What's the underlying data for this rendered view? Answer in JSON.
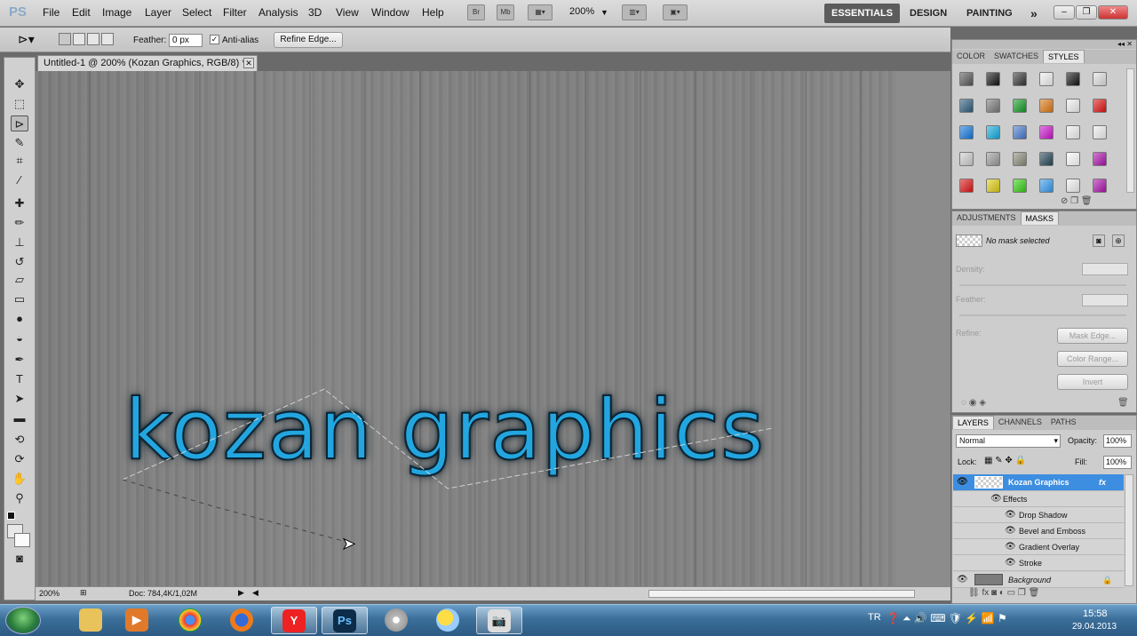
{
  "app": {
    "logo": "PS",
    "menu": [
      "File",
      "Edit",
      "Image",
      "Layer",
      "Select",
      "Filter",
      "Analysis",
      "3D",
      "View",
      "Window",
      "Help"
    ],
    "bridge_button": "Br",
    "minibridge_button": "Mb",
    "zoom": "200%",
    "workspaces": {
      "active": "ESSENTIALS",
      "items": [
        "DESIGN",
        "PAINTING"
      ],
      "more": "»"
    }
  },
  "options": {
    "feather_label": "Feather:",
    "feather_value": "0 px",
    "antialias_label": "Anti-alias",
    "antialias_checked": true,
    "refine_edge": "Refine Edge..."
  },
  "document": {
    "tab_title": "Untitled-1 @ 200% (Kozan Graphics, RGB/8) *",
    "canvas_text": "kozan graphics",
    "zoom": "200%",
    "doc_info": "Doc: 784,4K/1,02M"
  },
  "colors": {
    "accent": "#23a6e0",
    "canvas": "#808080"
  },
  "swatch_panel": {
    "tabs": [
      "COLOR",
      "SWATCHES",
      "STYLES"
    ],
    "active_tab": "STYLES",
    "styles": [
      "#555",
      "#111",
      "#333",
      "#eee",
      "#111",
      "#ddd",
      "#2b5a7c",
      "#777",
      "#119922",
      "#dd7711",
      "#eee",
      "#dd1111",
      "#1177dd",
      "#11aadd",
      "#4477cc",
      "#cc11cc",
      "#eee",
      "#eee",
      "#ccc",
      "#999",
      "#888877",
      "#224455",
      "#fafafa",
      "#aa11aa",
      "#dd1111",
      "#ddcc11",
      "#33cc11",
      "#3399ee",
      "#eee",
      "#aa11aa"
    ]
  },
  "masks": {
    "tabs": [
      "ADJUSTMENTS",
      "MASKS"
    ],
    "active_tab": "MASKS",
    "status": "No mask selected",
    "density_label": "Density:",
    "feather_label": "Feather:",
    "refine_label": "Refine:",
    "buttons": [
      "Mask Edge...",
      "Color Range...",
      "Invert"
    ]
  },
  "layers": {
    "tabs": [
      "LAYERS",
      "CHANNELS",
      "PATHS"
    ],
    "active_tab": "LAYERS",
    "blend_mode": "Normal",
    "opacity_label": "Opacity:",
    "opacity": "100%",
    "lock_label": "Lock:",
    "fill_label": "Fill:",
    "fill": "100%",
    "layer_name": "Kozan Graphics",
    "fx": "fx",
    "effects_label": "Effects",
    "effects": [
      "Drop Shadow",
      "Bevel and Emboss",
      "Gradient Overlay",
      "Stroke"
    ],
    "background_name": "Background"
  },
  "taskbar": {
    "language": "TR",
    "time": "15:58",
    "date": "29.04.2013",
    "ps_label": "Ps"
  }
}
